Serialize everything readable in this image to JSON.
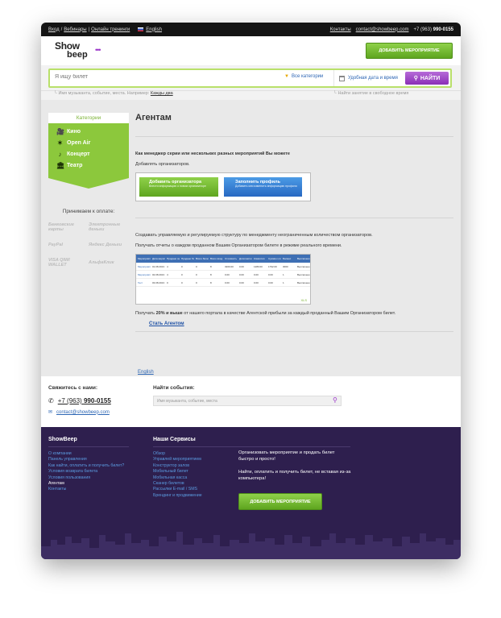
{
  "topbar": {
    "login": "Вход",
    "webinars": "Вебинары",
    "trainings": "Онлайн тренинги",
    "language": "English",
    "contacts": "Контакты",
    "email": "contact@showbeep.com",
    "phone_prefix": "+7 (963)",
    "phone_number": "990-0155"
  },
  "header": {
    "logo_top": "Show",
    "logo_bottom": "beep",
    "add_event_label": "Добавить мероприятие"
  },
  "search": {
    "placeholder": "Я ищу билет",
    "category_label": "Все категории",
    "date_label": "Удобная дата и время",
    "find_label": "НАЙТИ",
    "hint_text": "Имя музыканта, событие, места. Например:",
    "hint_example": "Кажды два",
    "hint_right": "Найти занятие в свободное время"
  },
  "sidebar": {
    "categories_title": "Категории",
    "categories": [
      {
        "label": "Кино",
        "icon": "film-camera-icon"
      },
      {
        "label": "Open Air",
        "icon": "open-air-icon"
      },
      {
        "label": "Концерт",
        "icon": "microphone-icon"
      },
      {
        "label": "Театр",
        "icon": "theater-icon"
      }
    ],
    "payment_title": "Принимаем к оплате:",
    "payments": [
      "Банковские карты",
      "Электронные деньги",
      "PayPal",
      "Яндекс Деньги",
      "VISA QIWI WALLET",
      "АльфаКлик"
    ]
  },
  "main": {
    "title": "Агентам",
    "intro_bold": "Как менеджер серии или нескольких разных мероприятий Вы можете",
    "intro_text": "Добавлять организаторов.",
    "promo_add_title": "Добавить организатора",
    "promo_add_sub": "Внести информацию о новом организаторе",
    "promo_fill_title": "Заполнить профиль",
    "promo_fill_sub": "Добавить или изменить информацию профиля",
    "text_manage": "Создавать управляемую и регулируемую структуру по менеджменту неограниченным количеством организаторов.",
    "text_reports": "Получать отчеты о каждом проданном Вашим Организатором билете в режиме реального времени.",
    "table_headers": [
      "Мероприятие",
      "Дата мероприятия",
      "Продано онлайн",
      "Продано билетов",
      "Всего билетов",
      "Всего вход.",
      "Стоимость билетов",
      "Дополнительные сервисы",
      "Комиссия",
      "Сумма к оплате",
      "Баланс",
      "Выплачено"
    ],
    "table_rows": [
      [
        "Мероприятие",
        "01.08.2013 19:00",
        "4",
        "0",
        "0",
        "8",
        "3200.00",
        "0.00",
        "1280.00",
        "1792.00",
        "3000",
        "Выплачено"
      ],
      [
        "Мероприятие",
        "02.08.2013 19:00",
        "4",
        "0",
        "0",
        "8",
        "0.00",
        "0.00",
        "0.00",
        "0.00",
        "1",
        "Выплачено"
      ],
      [
        "Тест",
        "03.08.2013 19:00",
        "0",
        "0",
        "0",
        "8",
        "0.00",
        "0.00",
        "0.00",
        "0.00",
        "1",
        "Выплачено"
      ]
    ],
    "table_footer": "XLS",
    "profit_prefix": "Получать",
    "profit_bold": "20% и выше",
    "profit_suffix": "от нашего портала в качестве Агентской прибыли за каждый проданный Вашим Организатором билет.",
    "agent_link": "Стать Агентом"
  },
  "language_link": "English",
  "contacts": {
    "title": "Свяжитесь с нами:",
    "phone_prefix": "+7 (963)",
    "phone_number": "990-0155",
    "email": "contact@showbeep.com",
    "find_title": "Найти события:",
    "find_placeholder": "Имя музыканта, событие, места"
  },
  "footer": {
    "col1_title": "ShowBeep",
    "col1_links": [
      "О компании",
      "Панель управления",
      "Как найти, оплатить и получить билет?",
      "Условия возврата билета",
      "Условия пользования",
      "Агентам",
      "Контакты"
    ],
    "col2_title": "Наши Сервисы",
    "col2_links": [
      "Обзор",
      "Управлей мероприятием",
      "Конструктор залов",
      "Мобильный билет",
      "Мобильная касса",
      "Сканер билетов",
      "Рассылки E-mail / SMS",
      "Брендинг и продвижение"
    ],
    "text1": "Организовать мероприятие и продать билет быстро и просто!",
    "text2": "Найти, оплатить и получить билет, не вставая из-за компьютера!",
    "button_label": "Добавить мероприятие"
  },
  "colors": {
    "accent_green": "#8cc83c",
    "accent_purple": "#9b36c9",
    "footer_bg": "#2e1f4e",
    "link_blue": "#2d66b4"
  }
}
